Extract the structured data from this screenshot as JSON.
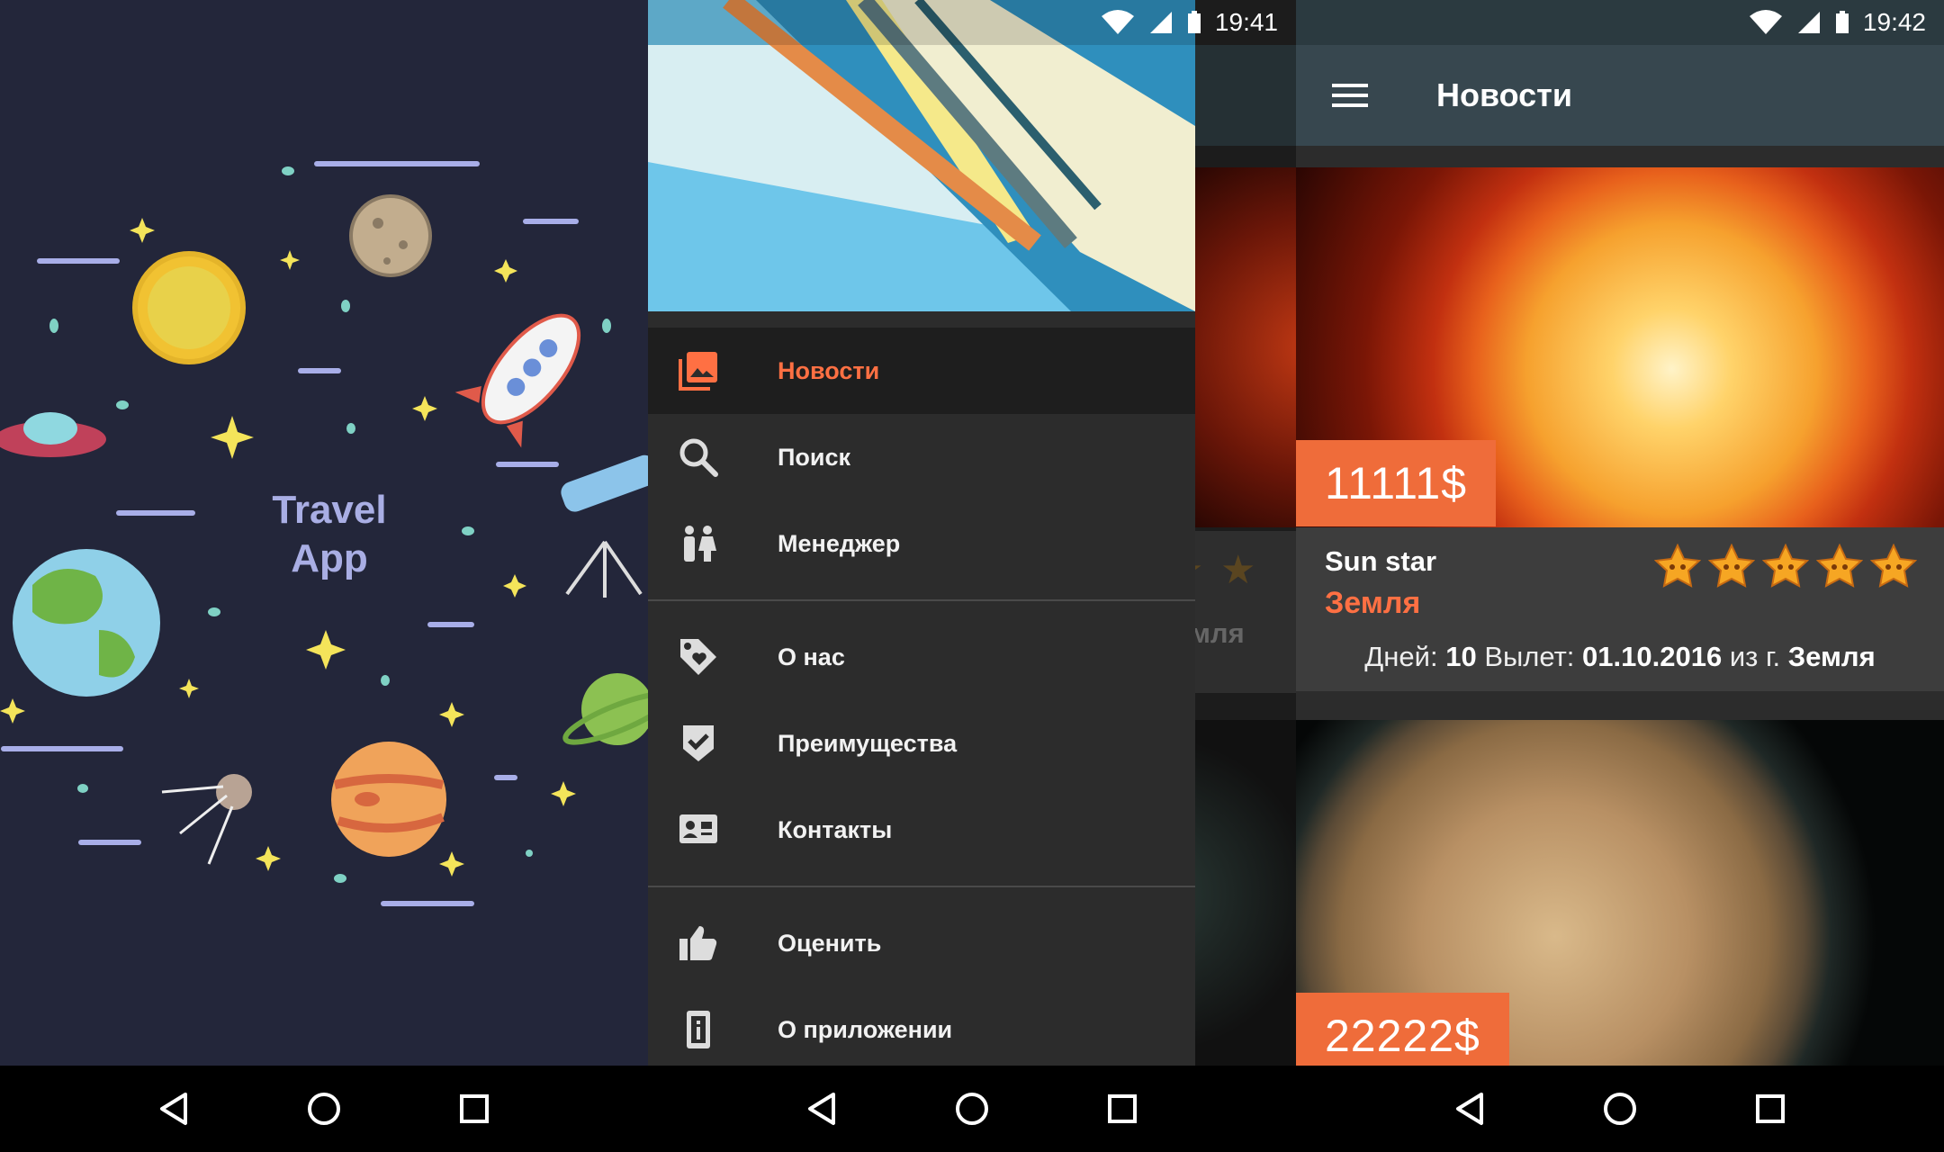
{
  "splash": {
    "title_line1": "Travel",
    "title_line2": "App"
  },
  "drawer_screen": {
    "status": {
      "time": "19:41"
    },
    "menu": {
      "items": [
        {
          "label": "Новости",
          "icon": "photo-library-icon",
          "active": true
        },
        {
          "label": "Поиск",
          "icon": "search-icon"
        },
        {
          "label": "Менеджер",
          "icon": "people-icon"
        }
      ],
      "items2": [
        {
          "label": "О нас",
          "icon": "tag-heart-icon"
        },
        {
          "label": "Преимущества",
          "icon": "verified-shield-icon"
        },
        {
          "label": "Контакты",
          "icon": "contact-card-icon"
        }
      ],
      "items3": [
        {
          "label": "Оценить",
          "icon": "thumb-up-icon"
        },
        {
          "label": "О приложении",
          "icon": "info-phone-icon"
        }
      ]
    },
    "behind": {
      "place_fragment": "мля"
    }
  },
  "news_screen": {
    "status": {
      "time": "19:42"
    },
    "appbar": {
      "title": "Новости"
    },
    "cards": [
      {
        "price": "11111$",
        "name": "Sun star",
        "place": "Земля",
        "rating": 5,
        "days_label": "Дней:",
        "days": "10",
        "depart_label": "Вылет:",
        "date": "01.10.2016",
        "from_label": "из г.",
        "city": "Земля"
      },
      {
        "price": "22222$"
      }
    ]
  },
  "colors": {
    "accent": "#ff7043",
    "price_bg": "#ef6c3a",
    "appbar": "#37474f",
    "splash_bg": "#23263a"
  }
}
